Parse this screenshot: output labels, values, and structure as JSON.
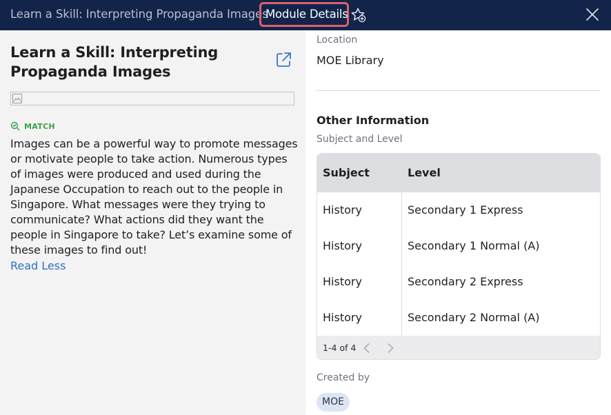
{
  "header": {
    "breadcrumb_parent": "Learn a Skill: Interpreting Propaganda Images",
    "breadcrumb_current": "Module Details"
  },
  "colors": {
    "header_bg": "#12244a",
    "highlight_border": "#e0606b",
    "match_green": "#3aa143",
    "link_blue": "#2d6fc4",
    "chip_bg": "#dce5f3"
  },
  "icons": {
    "star": "star-add-icon",
    "close": "close-icon",
    "external": "external-link-icon",
    "match": "match-search-icon",
    "prev": "chevron-left-icon",
    "next": "chevron-right-icon"
  },
  "left": {
    "title": "Learn a Skill: Interpreting Propaganda Images",
    "badge": "MATCH",
    "description": "Images can be a powerful way to promote messages or motivate people to take action. Numerous types of images were produced and used during the Japanese Occupation to reach out to the people in Singapore. What messages were they trying to communicate? What actions did they want the people in Singapore to take? Let’s examine some of these images to find out!",
    "read_less": "Read Less"
  },
  "right": {
    "location_label": "Location",
    "location_value": "MOE Library",
    "other_info_title": "Other Information",
    "subject_level_label": "Subject and Level",
    "table": {
      "headers": [
        "Subject",
        "Level"
      ],
      "rows": [
        [
          "History",
          "Secondary 1 Express"
        ],
        [
          "History",
          "Secondary 1 Normal (A)"
        ],
        [
          "History",
          "Secondary 2 Express"
        ],
        [
          "History",
          "Secondary 2 Normal (A)"
        ]
      ],
      "pagination": "1-4 of 4"
    },
    "created_by_label": "Created by",
    "created_by_value": "MOE"
  }
}
